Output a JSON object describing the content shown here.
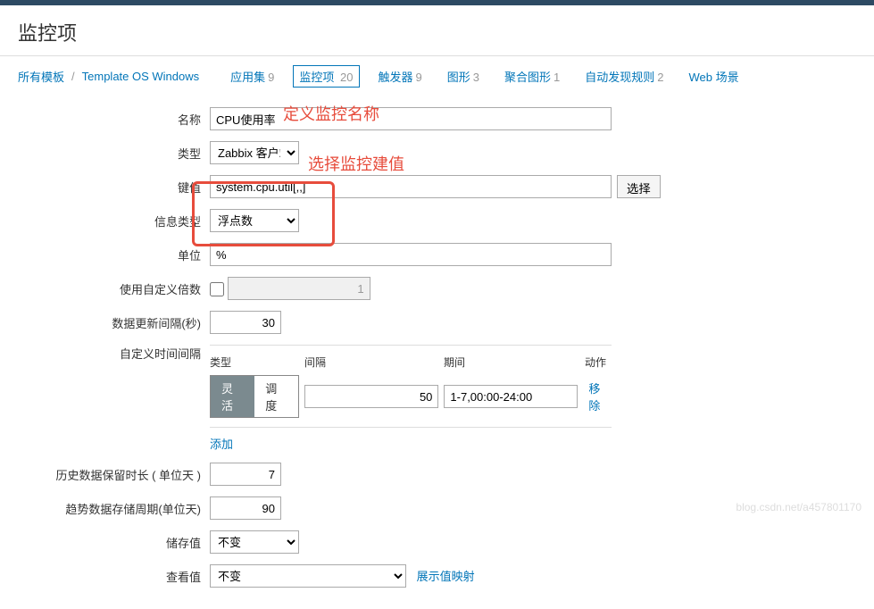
{
  "header": {
    "title": "监控项"
  },
  "breadcrumb": {
    "all_templates": "所有模板",
    "template_name": "Template OS Windows"
  },
  "tabs": [
    {
      "label": "应用集",
      "count": "9"
    },
    {
      "label": "监控项",
      "count": "20"
    },
    {
      "label": "触发器",
      "count": "9"
    },
    {
      "label": "图形",
      "count": "3"
    },
    {
      "label": "聚合图形",
      "count": "1"
    },
    {
      "label": "自动发现规则",
      "count": "2"
    },
    {
      "label": "Web 场景",
      "count": ""
    }
  ],
  "form": {
    "name": {
      "label": "名称",
      "value": "CPU使用率"
    },
    "type": {
      "label": "类型",
      "value": "Zabbix 客户端"
    },
    "key": {
      "label": "键值",
      "value": "system.cpu.util[,,]",
      "select_btn": "选择"
    },
    "info_type": {
      "label": "信息类型",
      "value": "浮点数"
    },
    "unit": {
      "label": "单位",
      "value": "%"
    },
    "custom_multiplier": {
      "label": "使用自定义倍数",
      "disabled_value": "1"
    },
    "update_interval": {
      "label": "数据更新间隔(秒)",
      "value": "30"
    },
    "custom_intervals": {
      "label": "自定义时间间隔",
      "headers": {
        "type": "类型",
        "interval": "间隔",
        "period": "期间",
        "action": "动作"
      },
      "toggle_flex": "灵活",
      "toggle_schedule": "调度",
      "interval_value": "50",
      "period_value": "1-7,00:00-24:00",
      "remove": "移除",
      "add": "添加"
    },
    "history_days": {
      "label": "历史数据保留时长 ( 单位天 )",
      "value": "7"
    },
    "trend_days": {
      "label": "趋势数据存储周期(单位天)",
      "value": "90"
    },
    "store_value": {
      "label": "储存值",
      "value": "不变"
    },
    "show_value": {
      "label": "查看值",
      "value": "不变",
      "link": "展示值映射"
    }
  },
  "annotations": {
    "name_hint": "定义监控名称",
    "key_hint": "选择监控建值"
  },
  "watermark": "blog.csdn.net/a457801170"
}
